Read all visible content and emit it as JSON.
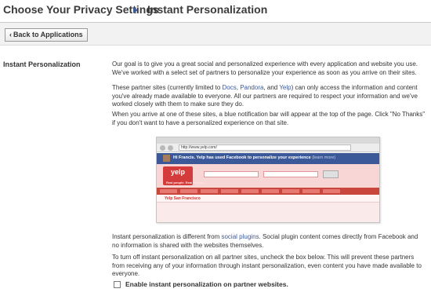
{
  "header": {
    "title": "Choose Your Privacy Settings",
    "subtitle": "Instant Personalization"
  },
  "toolbar": {
    "back_label": "Back to Applications"
  },
  "section": {
    "label": "Instant Personalization"
  },
  "content": {
    "p1": "Our goal is to give you a great social and personalized experience with every application and website you use. We've worked with a select set of partners to personalize your experience as soon as you arrive on their sites.",
    "p2_before": "These partner sites (currently limited to ",
    "p2_link_docs": "Docs",
    "p2_comma": ", ",
    "p2_link_pandora": "Pandora",
    "p2_and": ", and ",
    "p2_link_yelp": "Yelp",
    "p2_after": ") can only access the information and content you've already made available to everyone. All our partners are required to respect your information and we've worked closely with them to make sure they do.",
    "p3": "When you arrive at one of these sites, a blue notification bar will appear at the top of the page. Click \"No Thanks\" if you don't want to have a personalized experience on that site.",
    "p4_before": "Instant personalization is different from ",
    "p4_link": "social plugins",
    "p4_after": ". Social plugin content comes directly from Facebook and no information is shared with the websites themselves.",
    "p5": "To turn off instant personalization on all partner sites, uncheck the box below. This will prevent these partners from receiving any of your information through instant personalization, even content you have made available to everyone."
  },
  "preview": {
    "url": "http://www.yelp.com/",
    "notification": "Hi Francis. Yelp has used Facebook to personalize your experience",
    "notification_link": "(learn more)",
    "logo": "yelp",
    "logo_tagline": "Real people. Real reviews.",
    "city": "Yelp San Francisco"
  },
  "checkbox": {
    "label": "Enable instant personalization on partner websites.",
    "checked": false
  },
  "colors": {
    "link": "#3b5998",
    "notification_bar": "#3b5998",
    "yelp_red": "#c9463d"
  }
}
